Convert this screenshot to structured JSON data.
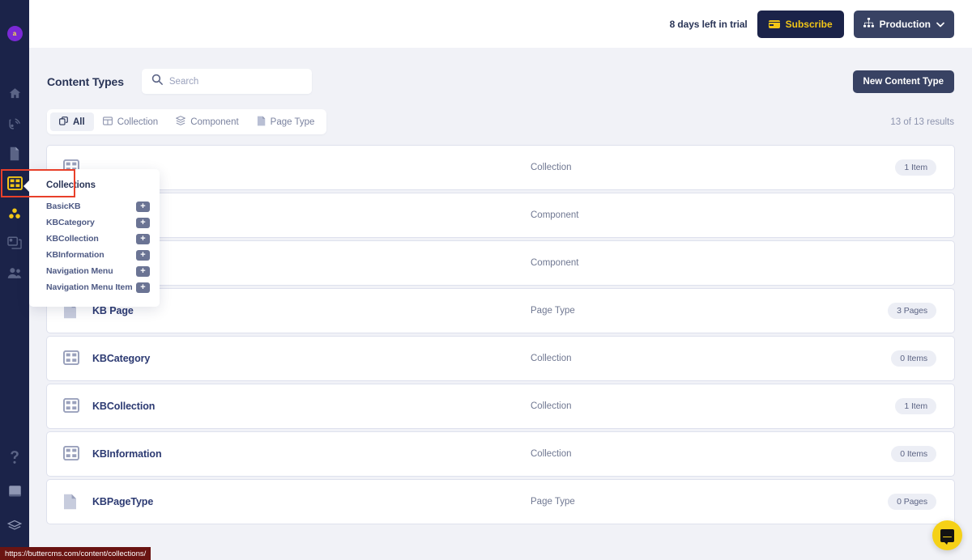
{
  "rail": {
    "avatar_initial": "a",
    "items": [
      {
        "name": "home",
        "label": "Home"
      },
      {
        "name": "blog",
        "label": "Blog"
      },
      {
        "name": "pages",
        "label": "Pages"
      },
      {
        "name": "collections",
        "label": "Collections",
        "active": true
      },
      {
        "name": "components",
        "label": "Components"
      },
      {
        "name": "media",
        "label": "Media"
      },
      {
        "name": "team",
        "label": "Team"
      }
    ],
    "bottom_items": [
      {
        "name": "help",
        "label": "Help"
      },
      {
        "name": "docs",
        "label": "Docs"
      },
      {
        "name": "api",
        "label": "API"
      }
    ]
  },
  "topbar": {
    "trial_text": "8 days left in trial",
    "subscribe_label": "Subscribe",
    "environment_label": "Production"
  },
  "header": {
    "title": "Content Types",
    "new_button_label": "New Content Type",
    "results_label": "13 of 13 results"
  },
  "search": {
    "value": "",
    "placeholder": "Search"
  },
  "filters": {
    "tabs": [
      {
        "label": "All",
        "active": true
      },
      {
        "label": "Collection",
        "active": false
      },
      {
        "label": "Component",
        "active": false
      },
      {
        "label": "Page Type",
        "active": false
      }
    ]
  },
  "flyout": {
    "title": "Collections",
    "items": [
      {
        "label": "BasicKB",
        "add_label": "+"
      },
      {
        "label": "KBCategory",
        "add_label": "+"
      },
      {
        "label": "KBCollection",
        "add_label": "+"
      },
      {
        "label": "KBInformation",
        "add_label": "+"
      },
      {
        "label": "Navigation Menu",
        "add_label": "+"
      },
      {
        "label": "Navigation Menu Item",
        "add_label": "+"
      }
    ]
  },
  "list": {
    "rows": [
      {
        "name": "",
        "icon": "collection-icon",
        "type": "Collection",
        "badge": "1 Item",
        "obscured": true
      },
      {
        "name": "",
        "icon": "component-icon",
        "type": "Component",
        "badge": "",
        "obscured": true
      },
      {
        "name": "",
        "icon": "component-icon",
        "type": "Component",
        "badge": "",
        "obscured": true
      },
      {
        "name": "KB Page",
        "icon": "page-type-icon",
        "type": "Page Type",
        "badge": "3 Pages",
        "obscured": false
      },
      {
        "name": "KBCategory",
        "icon": "collection-icon",
        "type": "Collection",
        "badge": "0 Items",
        "obscured": false
      },
      {
        "name": "KBCollection",
        "icon": "collection-icon",
        "type": "Collection",
        "badge": "1 Item",
        "obscured": false
      },
      {
        "name": "KBInformation",
        "icon": "collection-icon",
        "type": "Collection",
        "badge": "0 Items",
        "obscured": false
      },
      {
        "name": "KBPageType",
        "icon": "page-type-icon",
        "type": "Page Type",
        "badge": "0 Pages",
        "obscured": false
      }
    ]
  },
  "statusbar": {
    "url": "https://buttercms.com/content/collections/"
  },
  "colors": {
    "rail_bg": "#1b2349",
    "accent_yellow": "#f2c617",
    "page_bg": "#f1f2f7",
    "text_dark": "#2a3557",
    "link_blue": "#2c3a72",
    "highlight_red": "#e8402a",
    "avatar_purple": "#7b29d6"
  }
}
